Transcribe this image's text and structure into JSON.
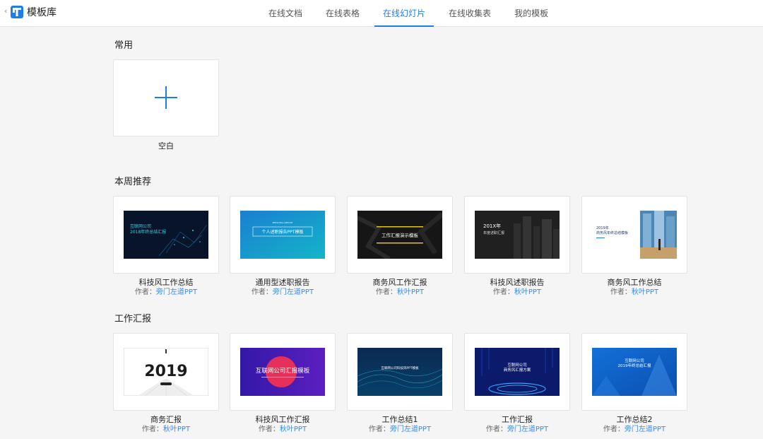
{
  "header": {
    "back": "‹",
    "logo_icon": "template-logo-icon",
    "title": "模板库",
    "tabs": [
      "在线文档",
      "在线表格",
      "在线幻灯片",
      "在线收集表",
      "我的模板"
    ],
    "active_tab": "在线幻灯片"
  },
  "sections": {
    "common": {
      "title": "常用",
      "blank_label": "空白",
      "blank_icon": "plus-icon"
    },
    "weekly": {
      "title": "本周推荐",
      "items": [
        {
          "name": "科技风工作总结",
          "author_label": "作者：",
          "author": "旁门左道PPT",
          "thumb_lines": [
            "互联网公司",
            "2018年终总结汇报"
          ]
        },
        {
          "name": "通用型述职报告",
          "author_label": "作者：",
          "author": "旁门左道PPT",
          "thumb_lines": [
            "PERSONAL REPORT",
            "个人述职报告PPT模板"
          ]
        },
        {
          "name": "商务风工作汇报",
          "author_label": "作者：",
          "author": "秋叶PPT",
          "thumb_lines": [
            "工作汇报演示模板"
          ]
        },
        {
          "name": "科技风述职报告",
          "author_label": "作者：",
          "author": "秋叶PPT",
          "thumb_lines": [
            "201X年",
            "年度述职汇报"
          ]
        },
        {
          "name": "商务风工作总结",
          "author_label": "作者：",
          "author": "秋叶PPT",
          "thumb_lines": [
            "2019年",
            "商务风年终总结模板"
          ]
        }
      ]
    },
    "work": {
      "title": "工作汇报",
      "items": [
        {
          "name": "商务汇报",
          "author_label": "作者：",
          "author": "秋叶PPT",
          "thumb_lines": [
            "2019"
          ]
        },
        {
          "name": "科技风工作汇报",
          "author_label": "作者：",
          "author": "秋叶PPT",
          "thumb_lines": [
            "互联网公司汇报模板"
          ]
        },
        {
          "name": "工作总结1",
          "author_label": "作者：",
          "author": "旁门左道PPT",
          "thumb_lines": [
            "互联网公司科技风PPT模板"
          ]
        },
        {
          "name": "工作汇报",
          "author_label": "作者：",
          "author": "旁门左道PPT",
          "thumb_lines": [
            "互联网公司",
            "商务风汇报方案"
          ]
        },
        {
          "name": "工作总结2",
          "author_label": "作者：",
          "author": "旁门左道PPT",
          "thumb_lines": [
            "互联网公司",
            "2019年终总结汇报"
          ]
        }
      ]
    }
  },
  "colors": {
    "accent": "#1e7ee6",
    "author_link": "#3a8ae8"
  }
}
